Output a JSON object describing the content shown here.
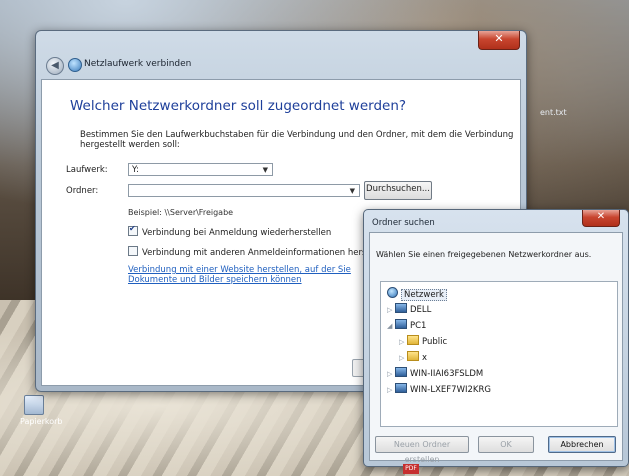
{
  "desktop": {
    "recycle_label": "Papierkorb",
    "file_label": "ent.txt",
    "pdf_label": "PDF"
  },
  "main_dialog": {
    "title": "Netzlaufwerk verbinden",
    "close_glyph": "✕",
    "back_glyph": "◀",
    "headline": "Welcher Netzwerkordner soll zugeordnet werden?",
    "instruction": "Bestimmen Sie den Laufwerkbuchstaben für die Verbindung und den Ordner, mit dem die Verbindung hergestellt werden soll:",
    "drive_label": "Laufwerk:",
    "drive_value": "Y:",
    "folder_label": "Ordner:",
    "folder_value": "",
    "browse_label": "Durchsuchen...",
    "example": "Beispiel: \\\\Server\\Freigabe",
    "reconnect_label": "Verbindung bei Anmeldung wiederherstellen",
    "reconnect_checked": true,
    "other_creds_label": "Verbindung mit anderen Anmeldeinformationen herstellen",
    "other_creds_checked": false,
    "website_link": "Verbindung mit einer Website herstellen, auf der Sie Dokumente und Bilder speichern können"
  },
  "folder_dialog": {
    "title": "Ordner suchen",
    "close_glyph": "✕",
    "instruction": "Wählen Sie einen freigegebenen Netzwerkordner aus.",
    "tree": {
      "root": "Netzwerk",
      "dell": "DELL",
      "pc1": "PC1",
      "public": "Public",
      "x": "x",
      "win1": "WIN-IIAI63FSLDM",
      "win2": "WIN-LXEF7WI2KRG"
    },
    "buttons": {
      "new_folder": "Neuen Ordner erstellen",
      "ok": "OK",
      "cancel": "Abbrechen"
    }
  }
}
